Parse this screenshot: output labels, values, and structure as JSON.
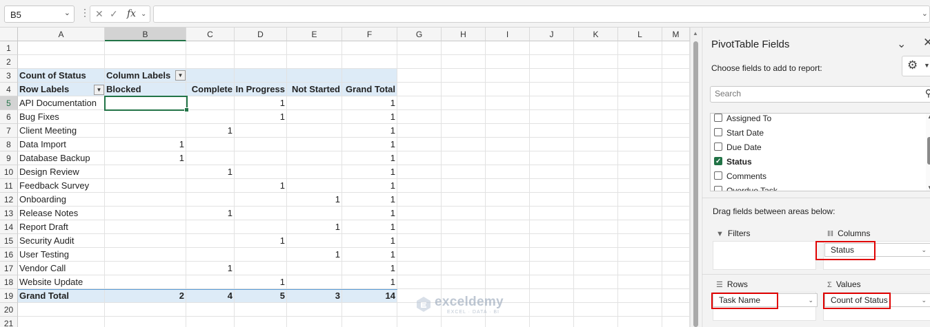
{
  "formula_bar": {
    "name_box": "B5",
    "fx_label": "fx",
    "formula": ""
  },
  "columns": [
    "A",
    "B",
    "C",
    "D",
    "E",
    "F",
    "G",
    "H",
    "I",
    "J",
    "K",
    "L",
    "M"
  ],
  "rows": [
    "1",
    "2",
    "3",
    "4",
    "5",
    "6",
    "7",
    "8",
    "9",
    "10",
    "11",
    "12",
    "13",
    "14",
    "15",
    "16",
    "17",
    "18",
    "19",
    "20",
    "21"
  ],
  "pivot": {
    "values_header": "Count of Status",
    "column_labels": "Column Labels",
    "row_labels": "Row Labels",
    "status_headers": [
      "Blocked",
      "Complete",
      "In Progress",
      "Not Started",
      "Grand Total"
    ],
    "rows": [
      {
        "label": "API Documentation",
        "values": [
          "",
          "",
          "1",
          "",
          "1"
        ]
      },
      {
        "label": "Bug Fixes",
        "values": [
          "",
          "",
          "1",
          "",
          "1"
        ]
      },
      {
        "label": "Client Meeting",
        "values": [
          "",
          "1",
          "",
          "",
          "1"
        ]
      },
      {
        "label": "Data Import",
        "values": [
          "1",
          "",
          "",
          "",
          "1"
        ]
      },
      {
        "label": "Database Backup",
        "values": [
          "1",
          "",
          "",
          "",
          "1"
        ]
      },
      {
        "label": "Design Review",
        "values": [
          "",
          "1",
          "",
          "",
          "1"
        ]
      },
      {
        "label": "Feedback Survey",
        "values": [
          "",
          "",
          "1",
          "",
          "1"
        ]
      },
      {
        "label": "Onboarding",
        "values": [
          "",
          "",
          "",
          "1",
          "1"
        ]
      },
      {
        "label": "Release Notes",
        "values": [
          "",
          "1",
          "",
          "",
          "1"
        ]
      },
      {
        "label": "Report Draft",
        "values": [
          "",
          "",
          "",
          "1",
          "1"
        ]
      },
      {
        "label": "Security Audit",
        "values": [
          "",
          "",
          "1",
          "",
          "1"
        ]
      },
      {
        "label": "User Testing",
        "values": [
          "",
          "",
          "",
          "1",
          "1"
        ]
      },
      {
        "label": "Vendor Call",
        "values": [
          "",
          "1",
          "",
          "",
          "1"
        ]
      },
      {
        "label": "Website Update",
        "values": [
          "",
          "",
          "1",
          "",
          "1"
        ]
      }
    ],
    "grand_total": {
      "label": "Grand Total",
      "values": [
        "2",
        "4",
        "5",
        "3",
        "14"
      ]
    }
  },
  "pane": {
    "title": "PivotTable Fields",
    "subtitle": "Choose fields to add to report:",
    "search_placeholder": "Search",
    "fields": [
      {
        "name": "Assigned To",
        "checked": false
      },
      {
        "name": "Start Date",
        "checked": false
      },
      {
        "name": "Due Date",
        "checked": false
      },
      {
        "name": "Status",
        "checked": true
      },
      {
        "name": "Comments",
        "checked": false
      },
      {
        "name": "Overdue Task",
        "checked": false
      }
    ],
    "drag_label": "Drag fields between areas below:",
    "areas": {
      "filters": {
        "label": "Filters"
      },
      "columns": {
        "label": "Columns",
        "item": "Status"
      },
      "rows": {
        "label": "Rows",
        "item": "Task Name"
      },
      "values": {
        "label": "Values",
        "item": "Count of Status"
      }
    }
  },
  "watermark": {
    "name": "exceldemy",
    "tagline": "EXCEL · DATA · BI"
  }
}
